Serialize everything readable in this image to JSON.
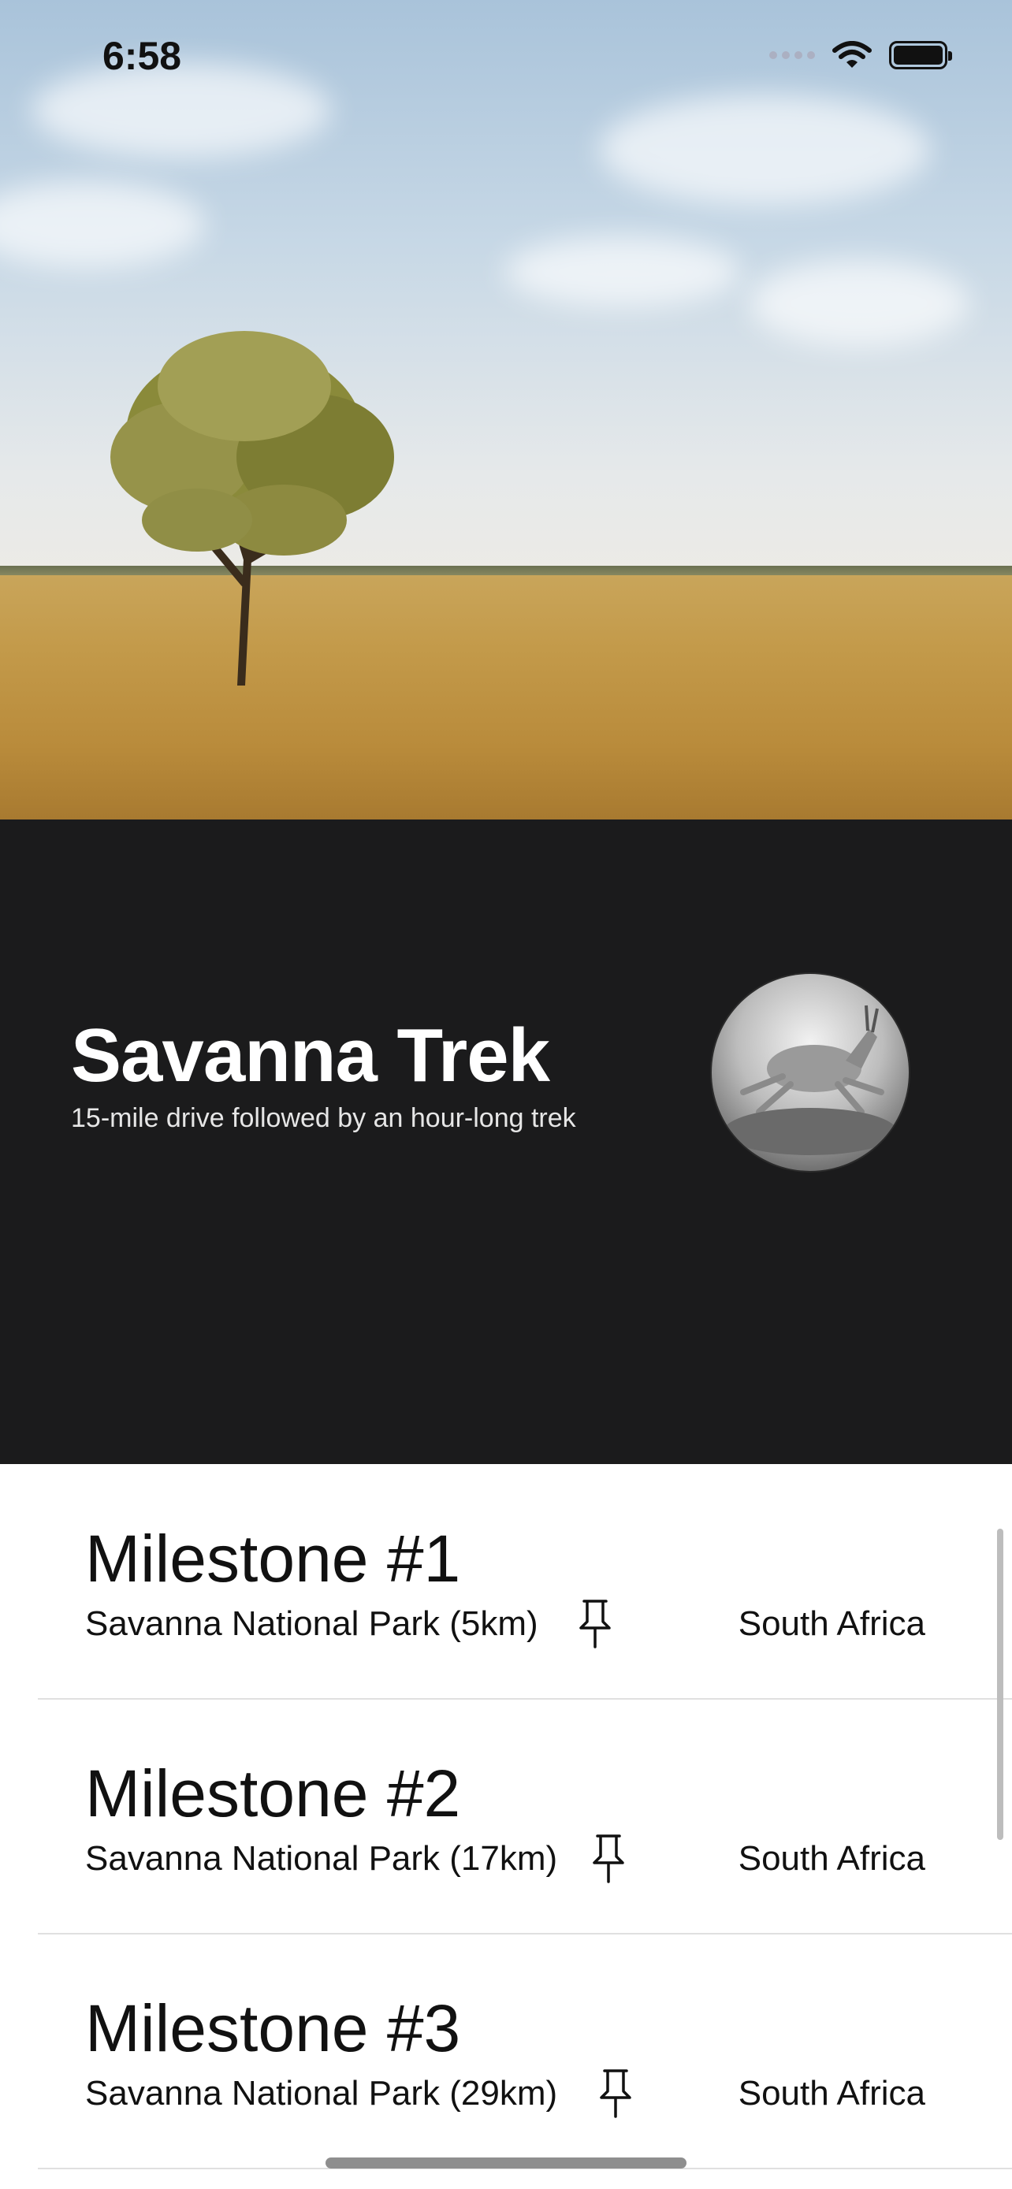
{
  "status_bar": {
    "time": "6:58",
    "icons": [
      "signal-icon",
      "wifi-icon",
      "battery-icon"
    ]
  },
  "hero": {
    "image": "savanna-tree-landscape"
  },
  "trek": {
    "title": "Savanna Trek",
    "subtitle": "15-mile drive followed by an hour-long trek",
    "avatar": "antelope-photo"
  },
  "milestones": [
    {
      "title": "Milestone #1",
      "park": "Savanna National Park (5km)",
      "country": "South Africa",
      "icon": "pin-icon"
    },
    {
      "title": "Milestone #2",
      "park": "Savanna National Park (17km)",
      "country": "South Africa",
      "icon": "pin-icon"
    },
    {
      "title": "Milestone #3",
      "park": "Savanna National Park (29km)",
      "country": "South Africa",
      "icon": "pin-icon"
    }
  ],
  "colors": {
    "panel_bg": "#1b1b1c",
    "text_light": "#ffffff",
    "text_dark": "#111111"
  }
}
